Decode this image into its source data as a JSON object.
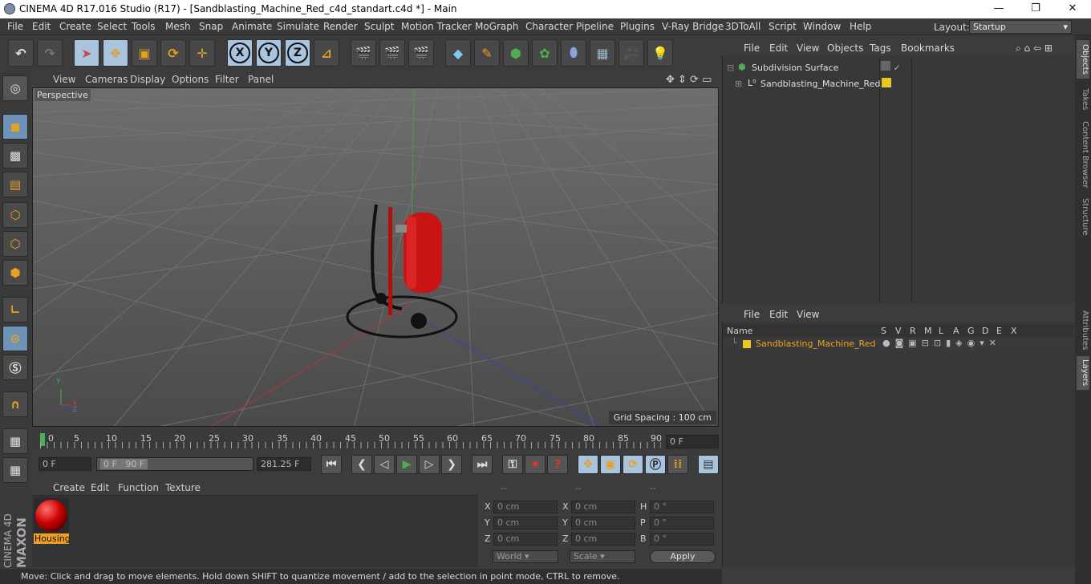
{
  "title_bar": {
    "title": "CINEMA 4D R17.016 Studio (R17) - [Sandblasting_Machine_Red_c4d_standart.c4d *] - Main",
    "minimize": "—",
    "maximize": "❐",
    "close": "✕"
  },
  "menu": [
    "File",
    "Edit",
    "Create",
    "Select",
    "Tools",
    "Mesh",
    "Snap",
    "Animate",
    "Simulate",
    "Render",
    "Sculpt",
    "Motion Tracker",
    "MoGraph",
    "Character",
    "Pipeline",
    "Plugins",
    "V-Ray Bridge",
    "3DToAll",
    "Script",
    "Window",
    "Help"
  ],
  "layout": {
    "label": "Layout:",
    "value": "Startup"
  },
  "toolbar": {
    "x": "X",
    "y": "Y",
    "z": "Z"
  },
  "viewport_menu": [
    "View",
    "Cameras",
    "Display",
    "Options",
    "Filter",
    "Panel"
  ],
  "viewport": {
    "camera_label": "Perspective",
    "grid_spacing": "Grid Spacing : 100 cm",
    "axis_x": "X",
    "axis_y": "Y",
    "axis_z": "Z"
  },
  "timeline": {
    "ticks": [
      "0",
      "5",
      "10",
      "15",
      "20",
      "25",
      "30",
      "35",
      "40",
      "45",
      "50",
      "55",
      "60",
      "65",
      "70",
      "75",
      "80",
      "85",
      "90"
    ],
    "current_frame": "0 F"
  },
  "playback": {
    "start_frame": "0 F",
    "range_start": "0 F",
    "range_end": "90 F",
    "fps_field": "281.25 F"
  },
  "material_menu": [
    "Create",
    "Edit",
    "Function",
    "Texture"
  ],
  "materials": [
    {
      "name": "Housing"
    }
  ],
  "coords": {
    "headers": [
      "--",
      "--",
      "--"
    ],
    "pos": [
      {
        "axis": "X",
        "value": "0 cm"
      },
      {
        "axis": "Y",
        "value": "0 cm"
      },
      {
        "axis": "Z",
        "value": "0 cm"
      }
    ],
    "size": [
      {
        "axis": "X",
        "value": "0 cm"
      },
      {
        "axis": "Y",
        "value": "0 cm"
      },
      {
        "axis": "Z",
        "value": "0 cm"
      }
    ],
    "rot": [
      {
        "axis": "H",
        "value": "0 °"
      },
      {
        "axis": "P",
        "value": "0 °"
      },
      {
        "axis": "B",
        "value": "0 °"
      }
    ],
    "world_select": "World",
    "scale_select": "Scale",
    "apply": "Apply"
  },
  "status": "Move: Click and drag to move elements. Hold down SHIFT to quantize movement / add to the selection in point mode, CTRL to remove.",
  "objects_menu": [
    "File",
    "Edit",
    "View",
    "Objects",
    "Tags",
    "Bookmarks"
  ],
  "objects": [
    {
      "name": "Subdivision Surface"
    },
    {
      "name": "Sandblasting_Machine_Red"
    }
  ],
  "layers_menu": [
    "File",
    "Edit",
    "View"
  ],
  "layers_header": {
    "name": "Name",
    "cols": [
      "S",
      "V",
      "R",
      "M",
      "L",
      "A",
      "G",
      "D",
      "E",
      "X"
    ]
  },
  "layers": [
    {
      "name": "Sandblasting_Machine_Red",
      "color": "#e8c81e"
    }
  ],
  "right_tabs": [
    "Objects",
    "Takes",
    "Content Browser",
    "Structure",
    "Attributes",
    "Layers"
  ],
  "brand": {
    "maxon": "MAXON",
    "cinema": "CINEMA 4D"
  },
  "colors": {
    "accent_blue": "#6a8fb5",
    "layer_orange": "#f0a020",
    "layer_yellow": "#e8c81e"
  }
}
